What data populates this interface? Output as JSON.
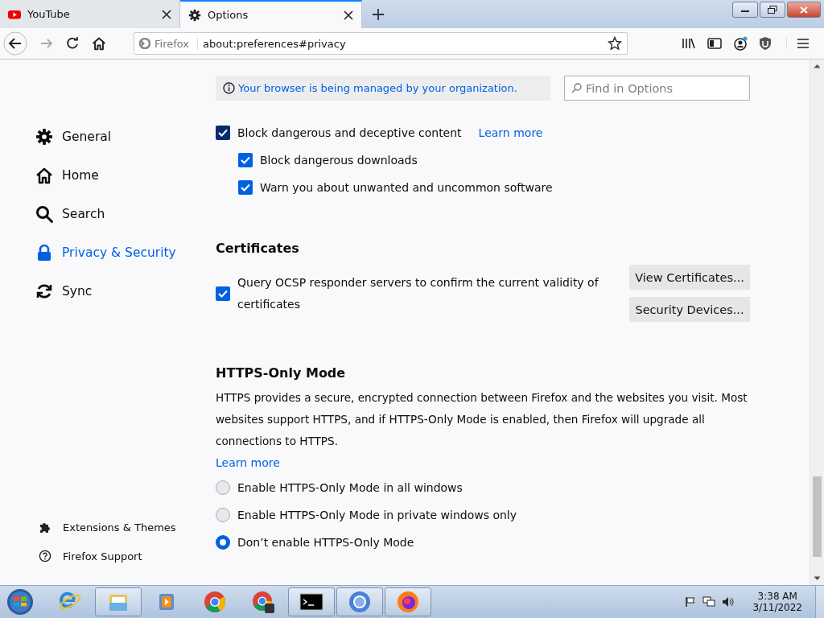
{
  "tabs": [
    {
      "label": "YouTube",
      "selected": false,
      "kind": "video"
    },
    {
      "label": "Options",
      "selected": true,
      "kind": "settings"
    }
  ],
  "address_bar": {
    "identity": "Firefox",
    "url": "about:preferences#privacy"
  },
  "notice": "Your browser is being managed by your organization.",
  "search": {
    "placeholder": "Find in Options"
  },
  "sidebar": {
    "items": [
      {
        "label": "General",
        "selected": false,
        "kind": "settings"
      },
      {
        "label": "Home",
        "selected": false,
        "kind": "home"
      },
      {
        "label": "Search",
        "selected": false,
        "kind": "search"
      },
      {
        "label": "Privacy & Security",
        "selected": true,
        "kind": "lock"
      },
      {
        "label": "Sync",
        "selected": false,
        "kind": "sync"
      }
    ],
    "footer_items": [
      {
        "label": "Extensions & Themes",
        "kind": "puzzle"
      },
      {
        "label": "Firefox Support",
        "kind": "help"
      }
    ]
  },
  "deceptive": {
    "checkboxes": [
      {
        "label": "Block dangerous and deceptive content",
        "checked": true,
        "link": "Learn more",
        "children": [
          {
            "label": "Block dangerous downloads",
            "checked": true
          },
          {
            "label": "Warn you about unwanted and uncommon software",
            "checked": true
          }
        ]
      }
    ]
  },
  "certificates": {
    "title": "Certificates",
    "checkbox": {
      "label": "Query OCSP responder servers to confirm the current validity of certificates",
      "checked": true
    },
    "buttons": [
      "View Certificates...",
      "Security Devices..."
    ]
  },
  "https_only": {
    "title": "HTTPS-Only Mode",
    "description": "HTTPS provides a secure, encrypted connection between Firefox and the websites you visit. Most websites support HTTPS, and if HTTPS-Only Mode is enabled, then Firefox will upgrade all connections to HTTPS.",
    "link": "Learn more",
    "options": [
      {
        "label": "Enable HTTPS-Only Mode in all windows",
        "selected": false
      },
      {
        "label": "Enable HTTPS-Only Mode in private windows only",
        "selected": false
      },
      {
        "label": "Don’t enable HTTPS-Only Mode",
        "selected": true
      }
    ]
  },
  "taskbar": {
    "apps": [
      {
        "kind": "ie",
        "running": false
      },
      {
        "kind": "folder",
        "running": true
      },
      {
        "kind": "media",
        "running": false
      },
      {
        "kind": "chrome",
        "running": false
      },
      {
        "kind": "chrome-b",
        "running": false
      },
      {
        "kind": "terminal",
        "running": true
      },
      {
        "kind": "chromium",
        "running": true
      },
      {
        "kind": "firefox",
        "running": true
      }
    ],
    "time": "3:38 AM",
    "date": "3/11/2022"
  }
}
